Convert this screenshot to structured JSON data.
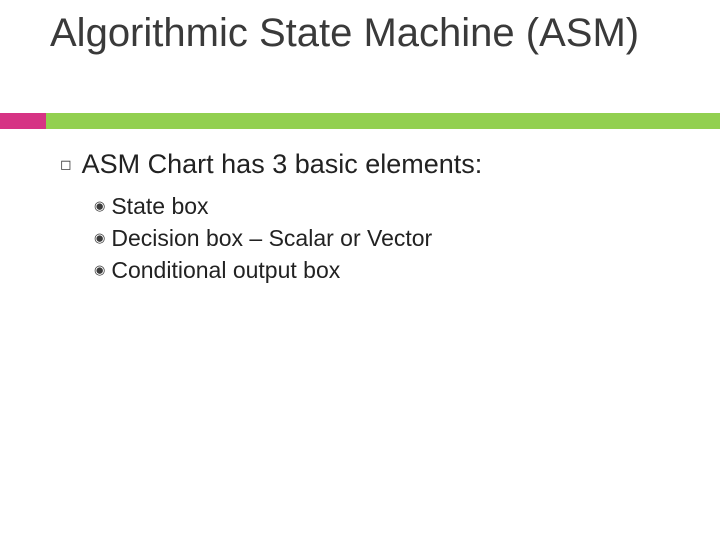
{
  "title": "Algorithmic State Machine (ASM)",
  "accent": {
    "bar": "#92d050",
    "tab": "#d63384"
  },
  "body": {
    "heading": "ASM Chart has 3 basic elements:",
    "items": [
      "State box",
      "Decision box – Scalar or Vector",
      "Conditional output box"
    ]
  },
  "bullets": {
    "square": "◻",
    "dot": "◉"
  }
}
